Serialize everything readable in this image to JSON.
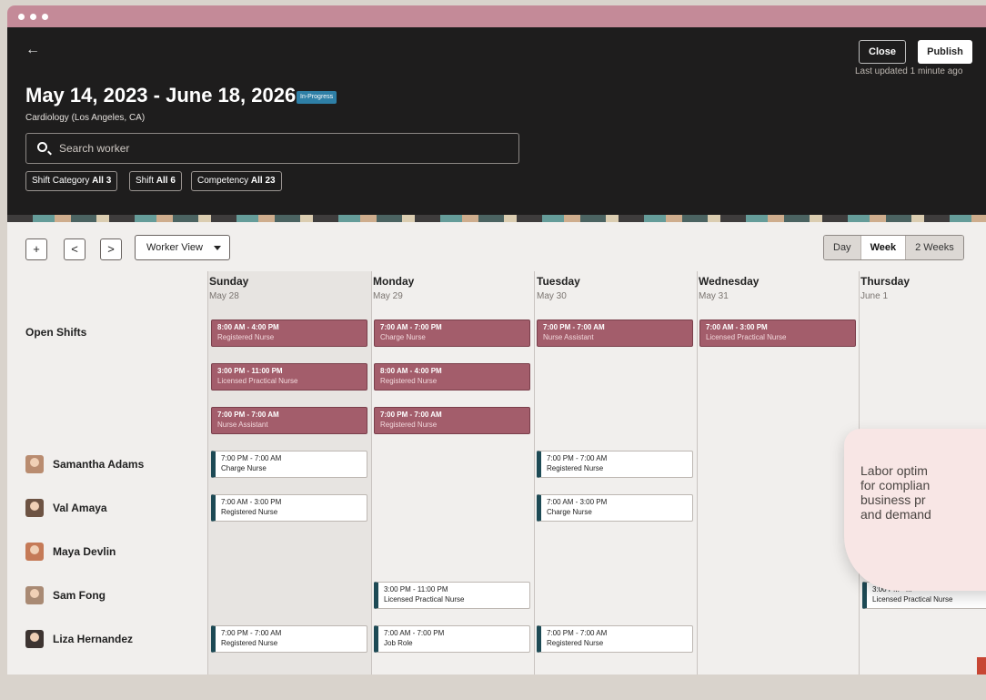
{
  "colors": {
    "titlebar": "#c48a98",
    "header_bg": "#1e1d1d",
    "open_shift": "#a35d6b",
    "assigned_marker": "#1d4a55",
    "status_badge": "#2e7fa6",
    "callout_bg": "#f8e6e5"
  },
  "header": {
    "back_icon": "arrow-left-icon",
    "close_label": "Close",
    "publish_label": "Publish",
    "last_updated": "Last updated 1 minute ago",
    "title": "May 14, 2023 - June 18, 2026",
    "status": "In-Progress",
    "subtitle": "Cardiology (Los Angeles, CA)",
    "search_placeholder": "Search worker",
    "filters": [
      {
        "label": "Shift Category",
        "count": "All 3"
      },
      {
        "label": "Shift",
        "count": "All 6"
      },
      {
        "label": "Competency",
        "count": "All 23"
      }
    ]
  },
  "toolbar": {
    "add_label": "+",
    "prev_label": "<",
    "next_label": ">",
    "view_label": "Worker View",
    "ranges": [
      "Day",
      "Week",
      "2 Weeks"
    ],
    "active_range": "Week"
  },
  "days": [
    {
      "name": "Sunday",
      "date": "May 28"
    },
    {
      "name": "Monday",
      "date": "May 29"
    },
    {
      "name": "Tuesday",
      "date": "May 30"
    },
    {
      "name": "Wednesday",
      "date": "May 31"
    },
    {
      "name": "Thursday",
      "date": "June 1"
    }
  ],
  "open_shifts_label": "Open Shifts",
  "open_shifts": [
    {
      "time": "8:00 AM - 4:00 PM",
      "role": "Registered Nurse"
    },
    {
      "time": "3:00 PM - 11:00 PM",
      "role": "Licensed Practical Nurse"
    },
    {
      "time": "7:00 PM - 7:00 AM",
      "role": "Nurse Assistant"
    },
    {
      "time": "7:00 AM - 7:00 PM",
      "role": "Charge Nurse"
    },
    {
      "time": "8:00 AM - 4:00 PM",
      "role": "Registered Nurse"
    },
    {
      "time": "7:00 PM - 7:00 AM",
      "role": "Registered Nurse"
    },
    {
      "time": "7:00 PM - 7:00 AM",
      "role": "Nurse Assistant"
    },
    {
      "time": "7:00 AM - 3:00 PM",
      "role": "Licensed Practical Nurse"
    }
  ],
  "workers": [
    {
      "name": "Samantha Adams"
    },
    {
      "name": "Val Amaya"
    },
    {
      "name": "Maya Devlin"
    },
    {
      "name": "Sam Fong"
    },
    {
      "name": "Liza Hernandez"
    }
  ],
  "assigned_shifts": [
    {
      "time": "7:00 PM - 7:00 AM",
      "role": "Charge Nurse"
    },
    {
      "time": "7:00 PM - 7:00 AM",
      "role": "Registered Nurse"
    },
    {
      "time": "7:00 AM - 3:00 PM",
      "role": "Registered Nurse"
    },
    {
      "time": "7:00 AM - 3:00 PM",
      "role": "Charge Nurse"
    },
    {
      "time": "3:00 PM - 11:00 PM",
      "role": "Licensed Practical Nurse"
    },
    {
      "time": "3:00 PM - ...",
      "role": "Licensed Practical Nurse"
    },
    {
      "time": "7:00 PM - 7:00 AM",
      "role": "Registered Nurse"
    },
    {
      "time": "7:00 AM - 7:00 PM",
      "role": "Job Role"
    },
    {
      "time": "7:00 PM - 7:00 AM",
      "role": "Registered Nurse"
    }
  ],
  "callout": {
    "line1": "Labor optim",
    "line2": "for complian",
    "line3": "business pr",
    "line4": "and demand"
  }
}
